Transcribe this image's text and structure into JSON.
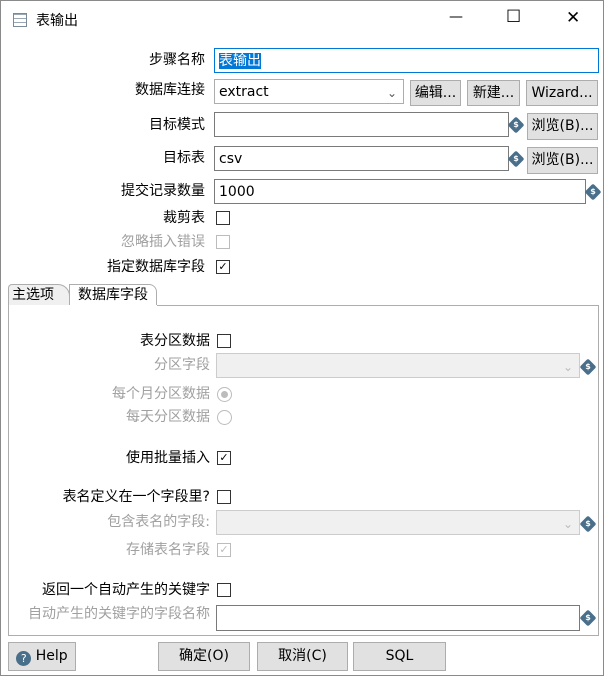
{
  "window": {
    "title": "表输出",
    "minimize": "—",
    "maximize": "☐",
    "close": "✕"
  },
  "form": {
    "step_name": {
      "label": "步骤名称",
      "value": "表输出"
    },
    "connection": {
      "label": "数据库连接",
      "value": "extract",
      "edit": "编辑...",
      "new": "新建...",
      "wizard": "Wizard..."
    },
    "target_schema": {
      "label": "目标模式",
      "value": "",
      "browse": "浏览(B)..."
    },
    "target_table": {
      "label": "目标表",
      "value": "csv",
      "browse": "浏览(B)..."
    },
    "commit_size": {
      "label": "提交记录数量",
      "value": "1000"
    },
    "truncate": {
      "label": "裁剪表",
      "checked": false
    },
    "ignore_errors": {
      "label": "忽略插入错误",
      "checked": false,
      "disabled": true
    },
    "specify_fields": {
      "label": "指定数据库字段",
      "checked": true
    }
  },
  "tabs": [
    {
      "label": "主选项",
      "active": true
    },
    {
      "label": "数据库字段",
      "active": false
    }
  ],
  "main": {
    "partition": {
      "label": "表分区数据",
      "checked": false
    },
    "partition_field": {
      "label": "分区字段",
      "value": ""
    },
    "monthly": {
      "label": "每个月分区数据",
      "selected": true
    },
    "daily": {
      "label": "每天分区数据",
      "selected": false
    },
    "batch": {
      "label": "使用批量插入",
      "checked": true
    },
    "table_in_field": {
      "label": "表名定义在一个字段里?",
      "checked": false
    },
    "table_field": {
      "label": "包含表名的字段:",
      "value": ""
    },
    "store_table_name": {
      "label": "存储表名字段",
      "checked": true
    },
    "return_key": {
      "label": "返回一个自动产生的关键字",
      "checked": false
    },
    "key_field": {
      "label": "自动产生的关键字的字段名称",
      "value": ""
    }
  },
  "footer": {
    "help": "Help",
    "ok": "确定(O)",
    "cancel": "取消(C)",
    "sql": "SQL"
  },
  "check_mark": "✓",
  "dollar": "$",
  "chevron": "⌄",
  "help_glyph": "?"
}
